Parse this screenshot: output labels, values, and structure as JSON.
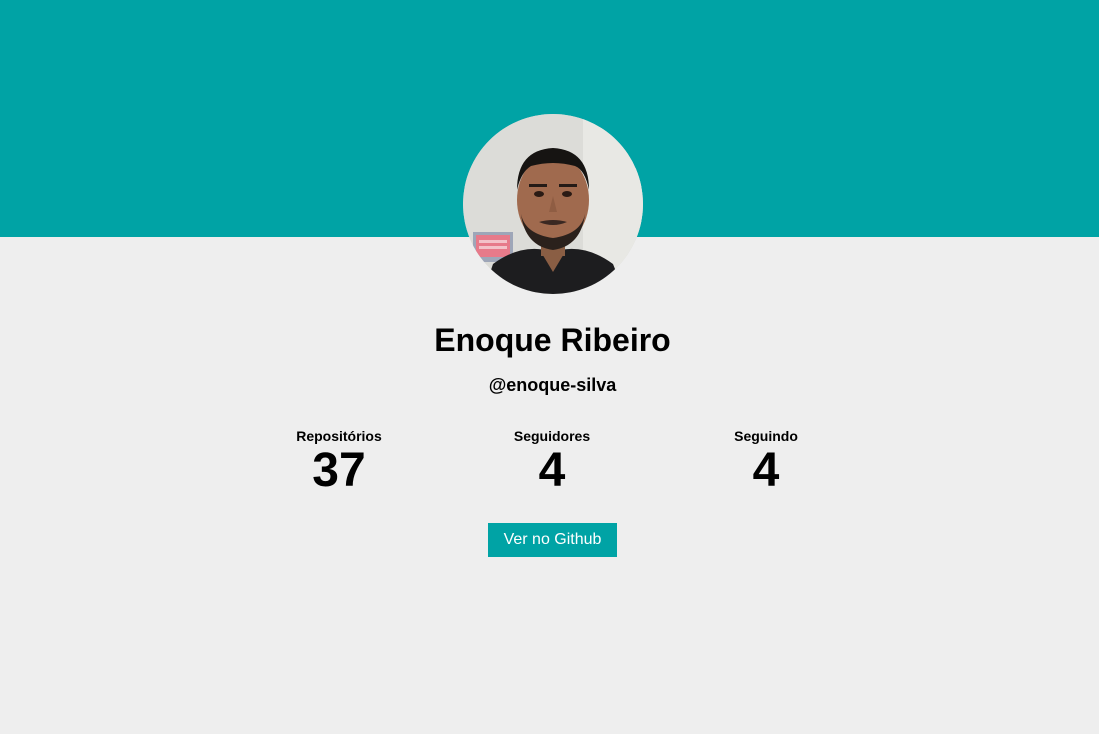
{
  "profile": {
    "name": "Enoque Ribeiro",
    "username": "@enoque-silva",
    "avatar_icon": "profile-photo"
  },
  "stats": {
    "repos": {
      "label": "Repositórios",
      "value": "37"
    },
    "followers": {
      "label": "Seguidores",
      "value": "4"
    },
    "following": {
      "label": "Seguindo",
      "value": "4"
    }
  },
  "actions": {
    "github_label": "Ver no Github"
  },
  "colors": {
    "accent": "#00a3a5",
    "background": "#eeeeee"
  }
}
